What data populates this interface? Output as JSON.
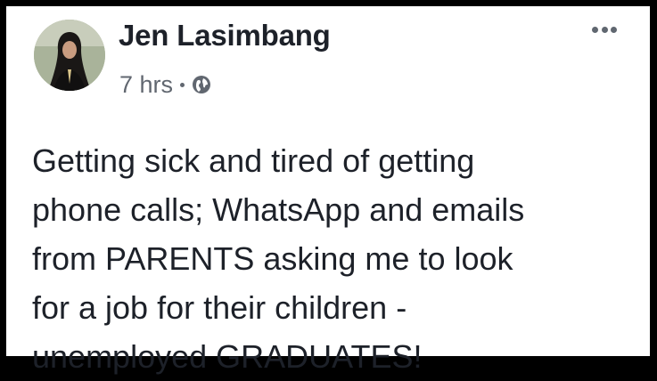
{
  "post": {
    "author": "Jen Lasimbang",
    "time": "7 hrs",
    "privacy_icon": "globe-icon",
    "more_icon": "more-options-icon",
    "text_lines": [
      "Getting sick and tired of getting",
      "phone calls; WhatsApp and emails",
      "from PARENTS asking me to look",
      "for a job for their children -",
      "unemployed GRADUATES!"
    ]
  },
  "colors": {
    "background": "#000000",
    "card": "#ffffff",
    "text": "#1d2129",
    "meta": "#616770"
  }
}
